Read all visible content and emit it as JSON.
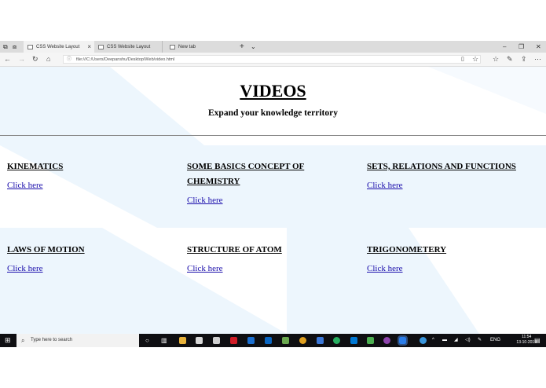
{
  "browser": {
    "tabs": [
      {
        "label": "CSS Website Layout"
      },
      {
        "label": "CSS Website Layout"
      },
      {
        "label": "New tab"
      }
    ],
    "url": "file:///C:/Users/Deepanshu/Desktop/Web/video.html"
  },
  "page": {
    "title": "VIDEOS",
    "subtitle": "Expand your knowledge territory",
    "cards": [
      {
        "title": "KINEMATICS",
        "link": "Click here"
      },
      {
        "title": "SOME BASICS CONCEPT OF CHEMISTRY",
        "link": "Click here"
      },
      {
        "title": "SETS, RELATIONS AND FUNCTIONS",
        "link": "Click here"
      },
      {
        "title": "LAWS OF MOTION",
        "link": "Click here"
      },
      {
        "title": "STRUCTURE OF ATOM",
        "link": "Click here"
      },
      {
        "title": "TRIGONOMETERY",
        "link": "Click here"
      }
    ]
  },
  "taskbar": {
    "search_placeholder": "Type here to search",
    "language": "ENG",
    "time": "11:54",
    "date": "13-10-2019"
  },
  "colors": {
    "link": "#1a0dab",
    "page_tint": "#edf6fd",
    "taskbar": "#0f0f12"
  }
}
